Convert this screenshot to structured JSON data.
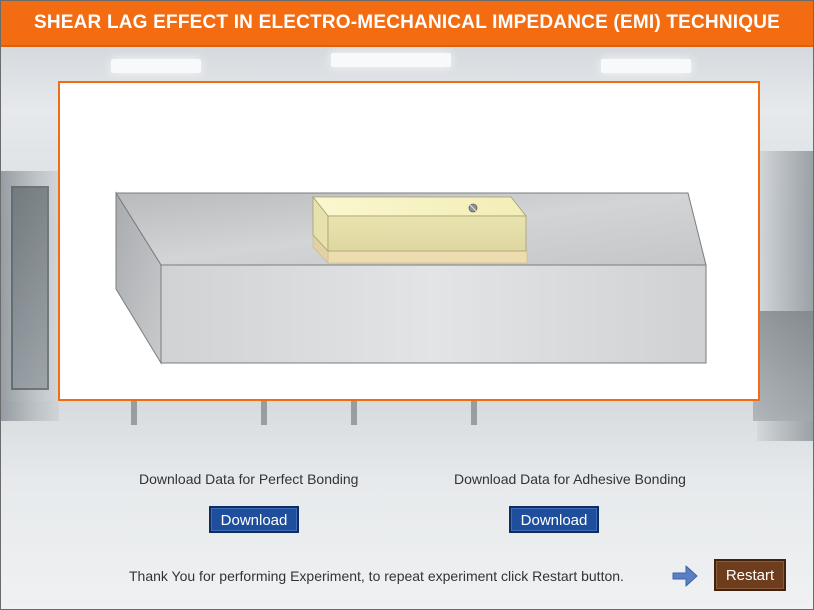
{
  "header": {
    "title": "SHEAR LAG EFFECT IN ELECTRO-MECHANICAL IMPEDANCE (EMI) TECHNIQUE"
  },
  "downloads": {
    "perfect": {
      "label": "Download Data for Perfect Bonding",
      "button_label": "Download"
    },
    "adhesive": {
      "label": "Download Data for Adhesive Bonding",
      "button_label": "Download"
    }
  },
  "footer": {
    "message": "Thank You for performing Experiment, to repeat experiment click Restart button.",
    "arrow_icon": "arrow-right-icon",
    "restart_label": "Restart"
  },
  "colors": {
    "header_bg": "#f36c12",
    "panel_border": "#f36c12",
    "download_button": "#1f4e9c",
    "restart_button": "#6d3d1d",
    "arrow": "#5a7fc4"
  }
}
